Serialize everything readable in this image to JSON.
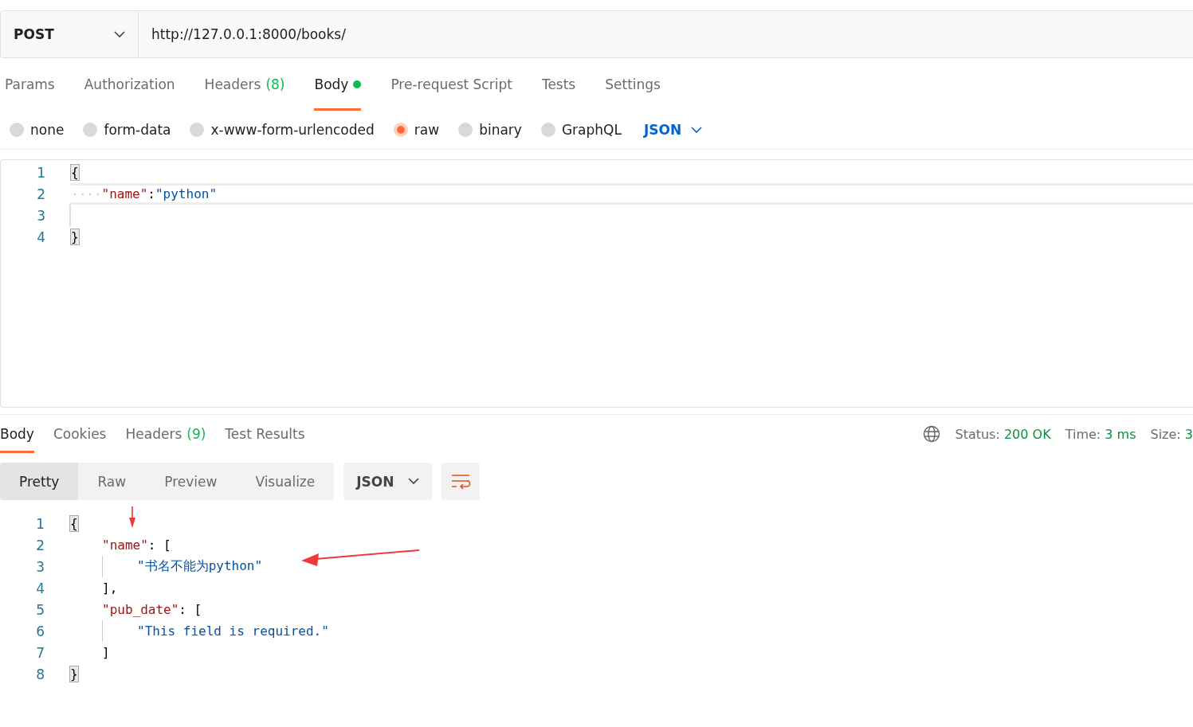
{
  "request": {
    "method": "POST",
    "url": "http://127.0.0.1:8000/books/"
  },
  "request_tabs": [
    {
      "label": "Params",
      "selected": false
    },
    {
      "label": "Authorization",
      "selected": false
    },
    {
      "label": "Headers",
      "count": "(8)",
      "selected": false
    },
    {
      "label": "Body",
      "dot": true,
      "selected": true
    },
    {
      "label": "Pre-request Script",
      "selected": false
    },
    {
      "label": "Tests",
      "selected": false
    },
    {
      "label": "Settings",
      "selected": false
    }
  ],
  "body_types": [
    {
      "label": "none",
      "selected": false
    },
    {
      "label": "form-data",
      "selected": false
    },
    {
      "label": "x-www-form-urlencoded",
      "selected": false
    },
    {
      "label": "raw",
      "selected": true
    },
    {
      "label": "binary",
      "selected": false
    },
    {
      "label": "GraphQL",
      "selected": false
    }
  ],
  "body_format": "JSON",
  "request_editor": [
    {
      "number": "1",
      "tokens": [
        {
          "kind": "brace",
          "text": "{"
        }
      ]
    },
    {
      "number": "2",
      "current": true,
      "tokens": [
        {
          "kind": "whitespace",
          "text": "····"
        },
        {
          "kind": "key",
          "text": "\"name\""
        },
        {
          "kind": "punct",
          "text": ":"
        },
        {
          "kind": "string",
          "text": "\"python\""
        }
      ]
    },
    {
      "number": "3",
      "guide": true
    },
    {
      "number": "4",
      "tokens": [
        {
          "kind": "brace",
          "text": "}"
        }
      ]
    }
  ],
  "response_tabs": [
    {
      "label": "Body",
      "selected": true
    },
    {
      "label": "Cookies",
      "selected": false
    },
    {
      "label": "Headers",
      "count": "(9)",
      "selected": false
    },
    {
      "label": "Test Results",
      "selected": false
    }
  ],
  "response_status": [
    {
      "label": "Status:",
      "value": "200 OK"
    },
    {
      "label": "Time:",
      "value": "3 ms"
    },
    {
      "label": "Size:",
      "value": "3"
    }
  ],
  "view_modes": [
    {
      "label": "Pretty",
      "selected": true
    },
    {
      "label": "Raw",
      "selected": false
    },
    {
      "label": "Preview",
      "selected": false
    },
    {
      "label": "Visualize",
      "selected": false
    }
  ],
  "response_format": "JSON",
  "response_editor": [
    {
      "number": "1",
      "tokens": [
        {
          "kind": "brace",
          "text": "{"
        }
      ]
    },
    {
      "number": "2",
      "kind": "nested",
      "tokens": [
        {
          "kind": "key",
          "text": "\"name\""
        },
        {
          "kind": "punct",
          "text": ": ["
        }
      ]
    },
    {
      "number": "3",
      "kind": "deep",
      "guide": true,
      "tokens": [
        {
          "kind": "string",
          "text": "\"书名不能为python\""
        }
      ]
    },
    {
      "number": "4",
      "kind": "nested",
      "tokens": [
        {
          "kind": "punct",
          "text": "],"
        }
      ]
    },
    {
      "number": "5",
      "kind": "nested",
      "tokens": [
        {
          "kind": "key",
          "text": "\"pub_date\""
        },
        {
          "kind": "punct",
          "text": ": ["
        }
      ]
    },
    {
      "number": "6",
      "kind": "deep",
      "guide": true,
      "tokens": [
        {
          "kind": "string",
          "text": "\"This field is required.\""
        }
      ]
    },
    {
      "number": "7",
      "kind": "nested",
      "tokens": [
        {
          "kind": "punct",
          "text": "]"
        }
      ]
    },
    {
      "number": "8",
      "tokens": [
        {
          "kind": "brace",
          "text": "}"
        }
      ]
    }
  ]
}
